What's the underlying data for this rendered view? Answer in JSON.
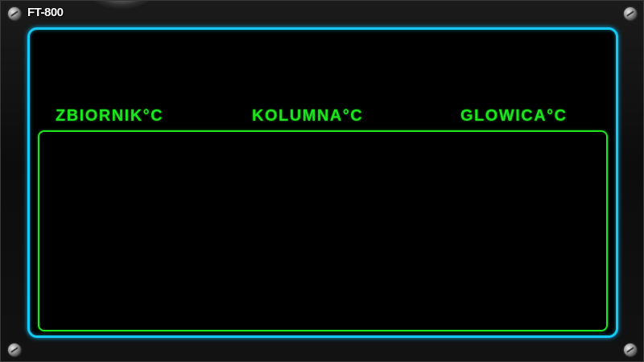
{
  "app": {
    "title": "FT-800"
  },
  "columns": {
    "zbiornik": "ZBIORNIK°C",
    "kolumna": "KOLUMNA°C",
    "glowica": "GLOWICA°C"
  },
  "colors": {
    "screen_border": "#16c8f2",
    "text_accent": "#1de51d",
    "background": "#000000"
  }
}
